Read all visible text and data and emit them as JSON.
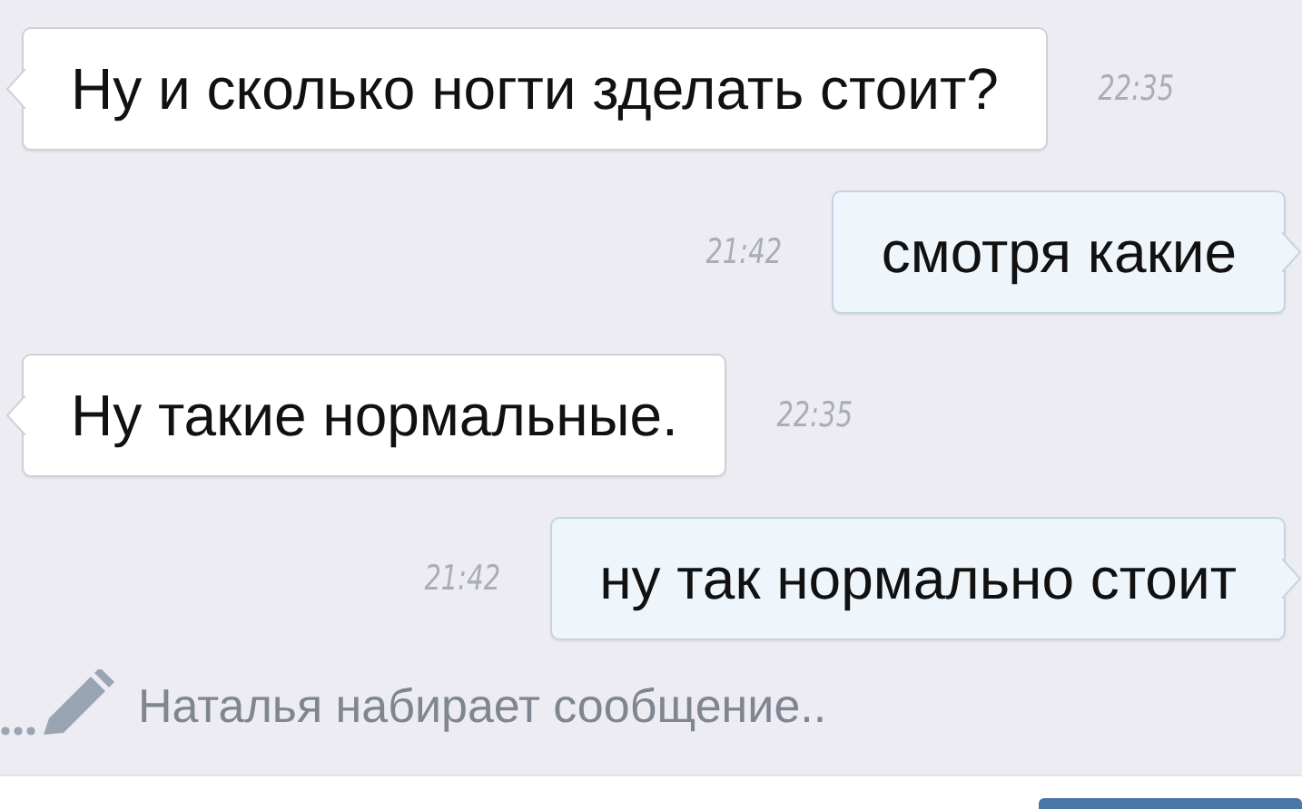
{
  "messages": [
    {
      "kind": "incoming",
      "text": "Ну и сколько ногти зделать стоит?",
      "time": "22:35"
    },
    {
      "kind": "outgoing",
      "text": "смотря какие",
      "time": "21:42"
    },
    {
      "kind": "incoming",
      "text": "Ну такие нормальные.",
      "time": "22:35"
    },
    {
      "kind": "outgoing",
      "text": "ну так нормально стоит",
      "time": "21:42"
    }
  ],
  "typing": {
    "text": "Наталья набирает сообщение.."
  }
}
